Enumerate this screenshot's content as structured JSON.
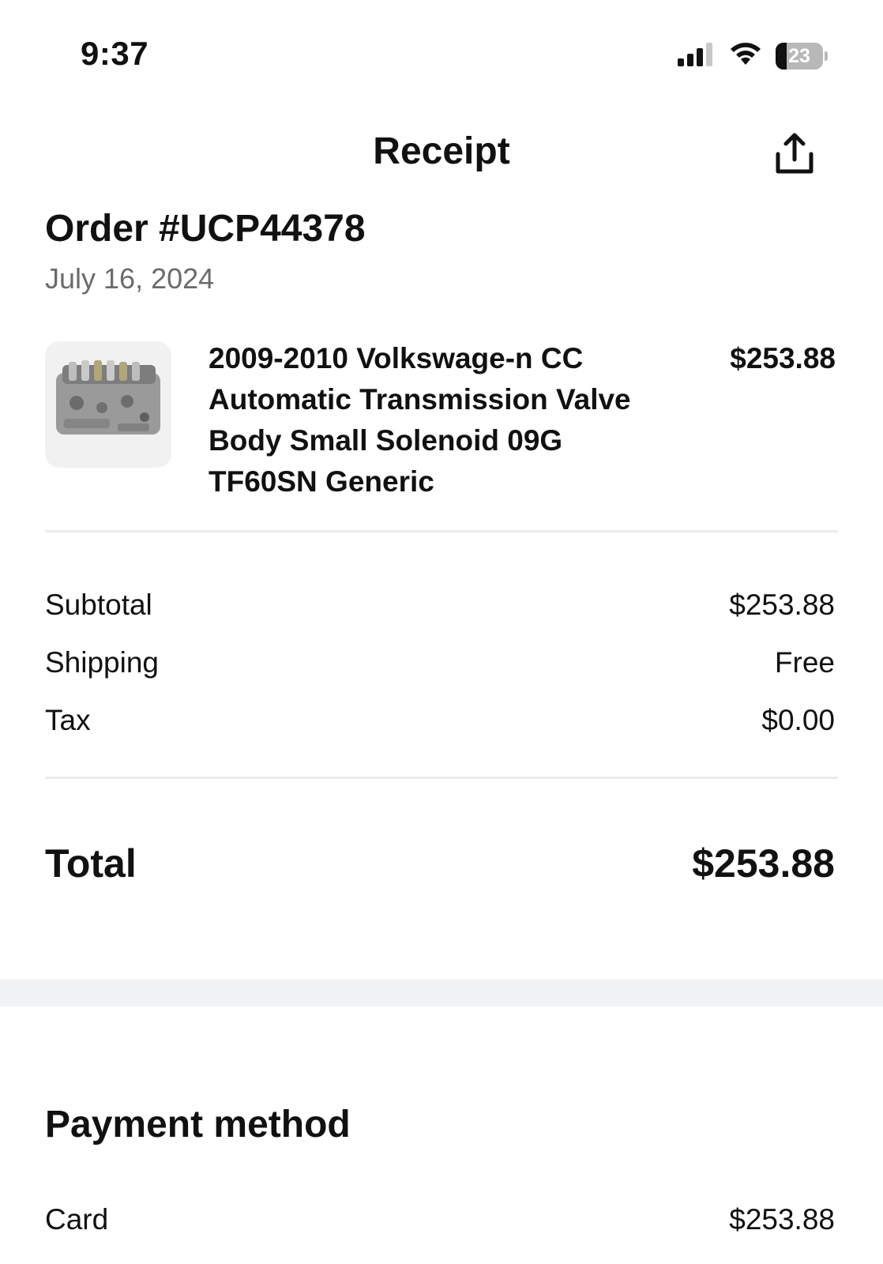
{
  "status_bar": {
    "time": "9:37",
    "battery_level": "23",
    "battery_percent": 23,
    "icons": [
      "cellular-signal-icon",
      "wifi-icon",
      "battery-icon"
    ]
  },
  "header": {
    "title": "Receipt",
    "share_icon": "share-icon"
  },
  "order": {
    "title": "Order #UCP44378",
    "date": "July 16, 2024"
  },
  "items": [
    {
      "name": "2009-2010 Volkswage-n CC Automatic Transmission Valve Body Small Solenoid 09G TF60SN Generic",
      "price": "$253.88"
    }
  ],
  "summary": {
    "subtotal_label": "Subtotal",
    "subtotal_value": "$253.88",
    "shipping_label": "Shipping",
    "shipping_value": "Free",
    "tax_label": "Tax",
    "tax_value": "$0.00",
    "total_label": "Total",
    "total_value": "$253.88"
  },
  "payment": {
    "title": "Payment method",
    "method_label": "Card",
    "method_amount": "$253.88"
  },
  "colors": {
    "text": "#111111",
    "muted": "#6b6b6b",
    "divider": "#ececec",
    "band": "#f1f2f4"
  }
}
